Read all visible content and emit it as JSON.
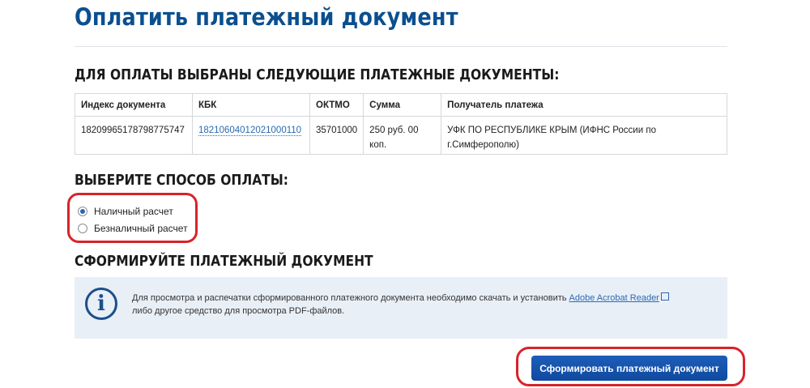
{
  "page_title": "Оплатить платежный документ",
  "docs_section": {
    "heading": "ДЛЯ ОПЛАТЫ ВЫБРАНЫ СЛЕДУЮЩИЕ ПЛАТЕЖНЫЕ ДОКУМЕНТЫ:",
    "columns": [
      "Индекс документа",
      "КБК",
      "ОКТМО",
      "Сумма",
      "Получатель платежа"
    ],
    "rows": [
      {
        "index": "18209965178798775747",
        "kbk": "18210604012021000110",
        "oktmo": "35701000",
        "sum": "250 руб. 00 коп.",
        "recipient": "УФК ПО РЕСПУБЛИКЕ КРЫМ (ИФНС России по г.Симферополю)"
      }
    ]
  },
  "payment_method": {
    "heading": "ВЫБЕРИТЕ СПОСОБ ОПЛАТЫ:",
    "options": [
      {
        "label": "Наличный расчет",
        "selected": true
      },
      {
        "label": "Безналичный расчет",
        "selected": false
      }
    ]
  },
  "form_section": {
    "heading": "СФОРМИРУЙТЕ ПЛАТЕЖНЫЙ ДОКУМЕНТ",
    "info_text_before": "Для просмотра и распечатки сформированного платежного документа необходимо скачать и установить ",
    "info_link": "Adobe Acrobat Reader",
    "info_text_after": "либо другое средство для просмотра PDF-файлов.",
    "info_icon": "info-icon",
    "submit_label": "Сформировать платежный документ"
  },
  "colors": {
    "title": "#0b4f8f",
    "accent_button": "#1d5db8",
    "annotation": "#d8232a",
    "info_bg": "#e9eff7"
  }
}
